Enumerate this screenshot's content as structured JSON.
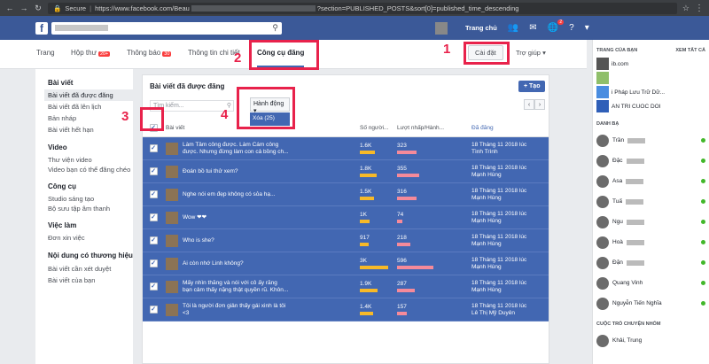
{
  "browser": {
    "secure_label": "Secure",
    "url_prefix": "https://www.facebook.com/Beau",
    "url_suffix": "?section=PUBLISHED_POSTS&sort[0]=published_time_descending"
  },
  "topbar": {
    "home_label": "Trang chủ",
    "notif_badge": "2"
  },
  "tabs": [
    {
      "label": "Trang",
      "count": ""
    },
    {
      "label": "Hộp thư",
      "count": "20+"
    },
    {
      "label": "Thông báo",
      "count": "30"
    },
    {
      "label": "Thông tin chi tiết",
      "count": ""
    },
    {
      "label": "Công cụ đăng",
      "count": ""
    }
  ],
  "settings_label": "Cài đặt",
  "help_label": "Trợ giúp ▾",
  "leftnav": {
    "sections": [
      {
        "head": "Bài viết",
        "items": [
          "Bài viết đã được đăng",
          "Bài viết đã lên lịch",
          "Bản nháp",
          "Bài viết hết hạn"
        ]
      },
      {
        "head": "Video",
        "items": [
          "Thư viện video",
          "Video bạn có thể đăng chéo"
        ]
      },
      {
        "head": "Công cụ",
        "items": [
          "Studio sáng tạo",
          "Bộ sưu tập âm thanh"
        ]
      },
      {
        "head": "Việc làm",
        "items": [
          "Đơn xin việc"
        ]
      },
      {
        "head": "Nội dung có thương hiệu",
        "items": [
          "Bài viết cần xét duyệt",
          "Bài viết của bạn"
        ]
      }
    ]
  },
  "panel": {
    "title": "Bài viết đã được đăng",
    "create_label": "+ Tạo",
    "search_placeholder": "Tìm kiếm...",
    "actions_label": "Hành động ▾",
    "actions_menu_item": "Xóa (25)"
  },
  "table": {
    "headers": {
      "post": "Bài viết",
      "reach": "Số người...",
      "engagement": "Lượt nhấp/Hành...",
      "published": "Đã đăng"
    },
    "rows": [
      {
        "text1": "Làm Tâm công được. Làm Cám công",
        "text2": "được. Nhưng đừng làm con cả bồng ch...",
        "reach": "1.6K",
        "eng": "323",
        "date": "18 Tháng 11 2018 lúc",
        "author": "Tình Trình",
        "reach_pct": 0.45,
        "eng_pct": 0.4
      },
      {
        "text1": "Đoán bồ tui thử xem?",
        "text2": "",
        "reach": "1.8K",
        "eng": "355",
        "date": "18 Tháng 11 2018 lúc",
        "author": "Mạnh Hùng",
        "reach_pct": 0.5,
        "eng_pct": 0.45
      },
      {
        "text1": "Nghe nói em đẹp không có sỏa hạ...",
        "text2": "",
        "reach": "1.5K",
        "eng": "316",
        "date": "18 Tháng 11 2018 lúc",
        "author": "Mạnh Hùng",
        "reach_pct": 0.42,
        "eng_pct": 0.4
      },
      {
        "text1": "Wow ❤❤",
        "text2": "",
        "reach": "1K",
        "eng": "74",
        "date": "18 Tháng 11 2018 lúc",
        "author": "Mạnh Hùng",
        "reach_pct": 0.28,
        "eng_pct": 0.1
      },
      {
        "text1": "Who is she?",
        "text2": "",
        "reach": "917",
        "eng": "218",
        "date": "18 Tháng 11 2018 lúc",
        "author": "Mạnh Hùng",
        "reach_pct": 0.25,
        "eng_pct": 0.28
      },
      {
        "text1": "Ai còn nhớ Linh không?",
        "text2": "",
        "reach": "3K",
        "eng": "596",
        "date": "18 Tháng 11 2018 lúc",
        "author": "Mạnh Hùng",
        "reach_pct": 0.85,
        "eng_pct": 0.75
      },
      {
        "text1": "Mấy nhìn thằng và nói với cô ấy rằng",
        "text2": "bạn cảm thấy nặng thật quyền rũ. Khôn...",
        "reach": "1.9K",
        "eng": "287",
        "date": "18 Tháng 11 2018 lúc",
        "author": "Mạnh Hùng",
        "reach_pct": 0.53,
        "eng_pct": 0.36
      },
      {
        "text1": "Tôi là người đơn giản thấy gái xinh là tôi",
        "text2": "<3",
        "reach": "1.4K",
        "eng": "157",
        "date": "18 Tháng 11 2018 lúc",
        "author": "Lê Thị Mỹ Duyên",
        "reach_pct": 0.39,
        "eng_pct": 0.2
      }
    ]
  },
  "rightbar": {
    "pages_head": "TRANG CỦA BẠN",
    "see_all": "XEM TẤT CẢ",
    "pages": [
      {
        "name": "ib.com",
        "color": "#555555"
      },
      {
        "name": "",
        "color": "#8fbf6a"
      },
      {
        "name": "i Pháp Lưu Trữ Dữ...",
        "color": "#4a8de0"
      },
      {
        "name": "AN TRI CUOC DOI",
        "color": "#2f5fb8"
      }
    ],
    "contacts_head": "DANH BẠ",
    "contacts": [
      "Trần",
      "Đặc",
      "Asa",
      "Tuấ",
      "Ngu",
      "Hoà",
      "Đặn",
      "Quang Vinh",
      "Nguyễn Tiến Nghĩa"
    ],
    "groups_head": "CUỘC TRÒ CHUYỆN NHÓM",
    "groups": [
      "Khải, Trung"
    ]
  },
  "annotations": [
    "1",
    "2",
    "3",
    "4"
  ]
}
